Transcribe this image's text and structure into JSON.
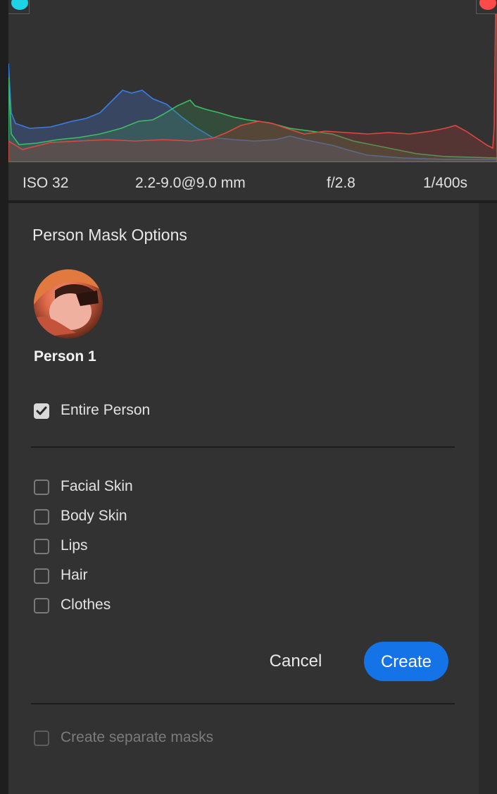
{
  "exif": {
    "iso": "ISO 32",
    "lens": "2.2-9.0@9.0 mm",
    "aperture": "f/2.8",
    "shutter": "1/400s"
  },
  "histogram": {
    "shadow_clip_color": "#1fd3e6",
    "highlight_clip_color": "#ff4a4a"
  },
  "panel": {
    "title": "Person Mask Options",
    "person": {
      "name": "Person 1"
    },
    "entire_person": {
      "label": "Entire Person",
      "checked": true
    },
    "parts": [
      {
        "label": "Facial Skin",
        "checked": false
      },
      {
        "label": "Body Skin",
        "checked": false
      },
      {
        "label": "Lips",
        "checked": false
      },
      {
        "label": "Hair",
        "checked": false
      },
      {
        "label": "Clothes",
        "checked": false
      }
    ],
    "buttons": {
      "cancel": "Cancel",
      "create": "Create"
    },
    "separate_masks": {
      "label": "Create separate masks",
      "checked": false,
      "disabled": true
    }
  },
  "colors": {
    "accent": "#1473e6",
    "panel_bg": "#323232"
  }
}
